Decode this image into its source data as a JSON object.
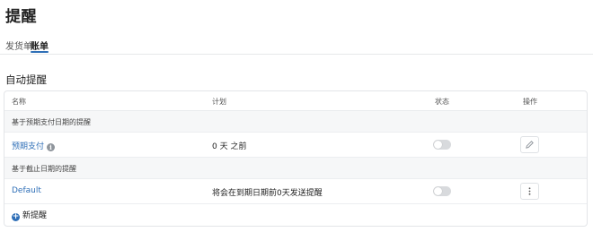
{
  "page": {
    "title": "提醒"
  },
  "tabs": [
    {
      "label": "发货单",
      "active": false
    },
    {
      "label": "账单",
      "active": true
    }
  ],
  "section": {
    "title": "自动提醒"
  },
  "table": {
    "headers": {
      "name": "名称",
      "plan": "计划",
      "status": "状态",
      "actions": "操作"
    },
    "groups": [
      {
        "label": "基于预期支付日期的提醒",
        "rows": [
          {
            "name": "预期支付",
            "plan": "0 天 之前",
            "enabled": false,
            "action_icon": "pencil-icon"
          }
        ]
      },
      {
        "label": "基于截止日期的提醒",
        "rows": [
          {
            "name": "Default",
            "plan": "将会在到期日期前0天发送提醒",
            "enabled": false,
            "action_icon": "more-vertical-icon"
          }
        ]
      }
    ]
  },
  "new_reminder": {
    "label": "新提醒"
  },
  "colors": {
    "accent": "#2f6fb7",
    "toggle_off": "#d8dadd",
    "group_bg": "#f6f7f8"
  }
}
